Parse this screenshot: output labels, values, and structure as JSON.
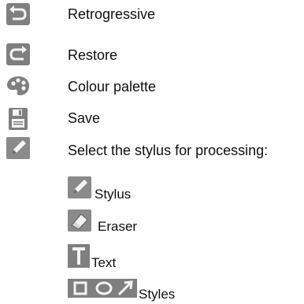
{
  "help_list": {
    "items": [
      {
        "label": "Retrogressive",
        "icon": "undo-icon"
      },
      {
        "label": "Restore",
        "icon": "redo-icon"
      },
      {
        "label": "Colour palette",
        "icon": "palette-icon"
      },
      {
        "label": "Save",
        "icon": "save-icon"
      },
      {
        "label": "Select the stylus for processing:",
        "icon": "pencil-icon"
      }
    ],
    "sub_items": [
      {
        "label": "Stylus",
        "icon": "pencil-icon"
      },
      {
        "label": "Eraser",
        "icon": "eraser-icon"
      },
      {
        "label": "Text",
        "icon": "text-tool-icon"
      },
      {
        "label": "Styles",
        "icons": [
          "rectangle-icon",
          "ellipse-icon",
          "arrow-icon"
        ]
      }
    ]
  },
  "colors": {
    "icon_gray": "#7f7f7f",
    "icon_dark": "#6c6c6c",
    "icon_light": "#f4f4f4",
    "text": "#111111"
  }
}
